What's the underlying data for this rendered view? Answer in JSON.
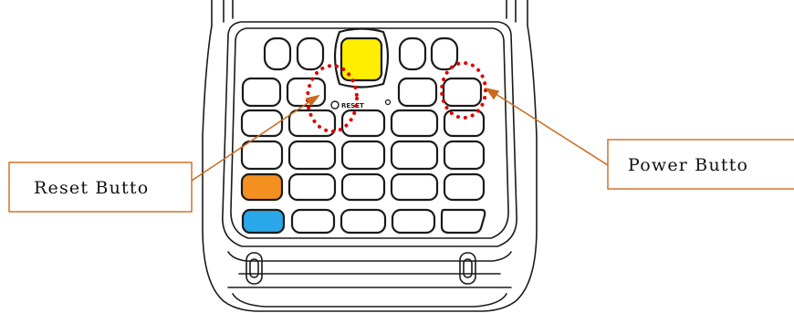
{
  "callouts": {
    "reset": {
      "label": "Reset Butto"
    },
    "power": {
      "label": "Power Butto"
    }
  },
  "device": {
    "reset_key_label": "RESET"
  },
  "colors": {
    "leader_line": "#cc6a1e",
    "highlight_dots": "#e00000",
    "center_key": "#ffee00",
    "left_key_orange": "#f39020",
    "left_key_blue": "#2aa7e8",
    "outline": "#1a1a1a"
  }
}
